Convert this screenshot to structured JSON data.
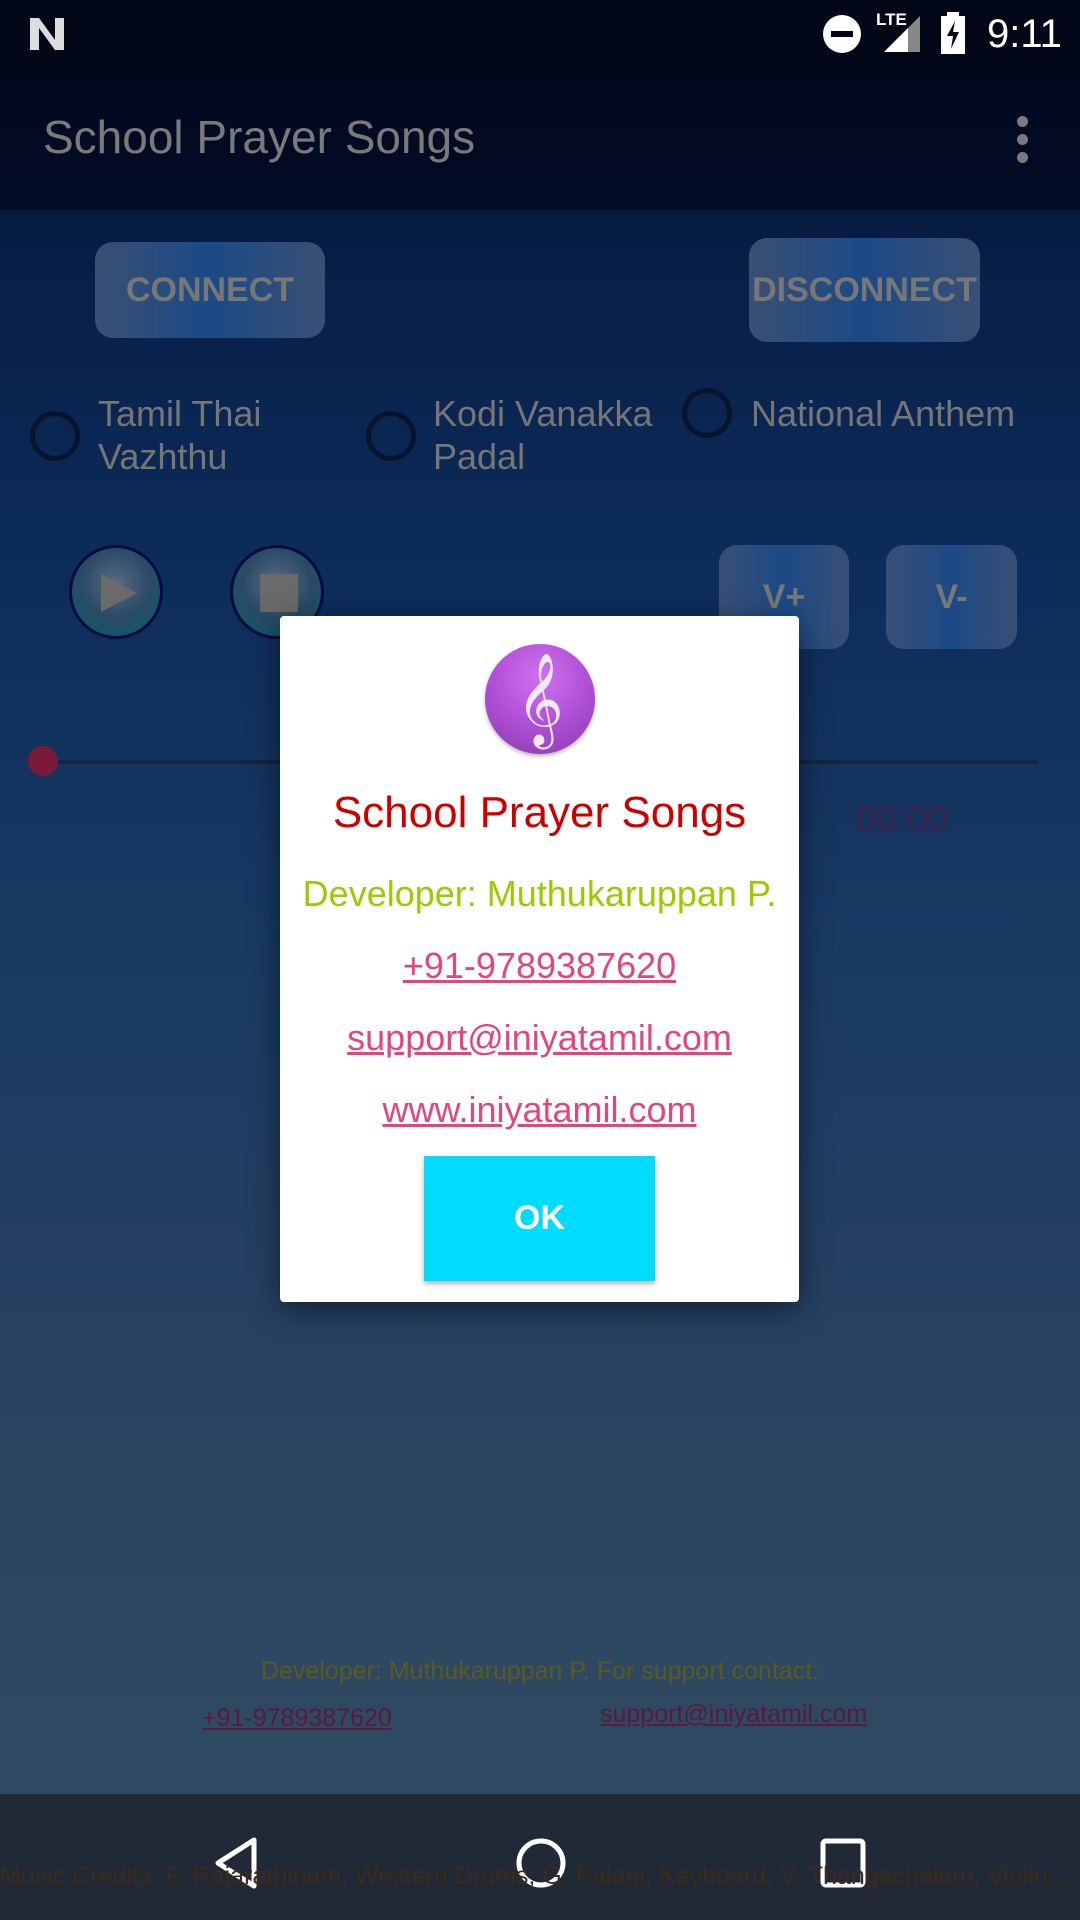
{
  "status_bar": {
    "time": "9:11",
    "network": "LTE",
    "icons": [
      "n-notification-icon",
      "do-not-disturb-icon",
      "signal-icon",
      "battery-charging-icon"
    ]
  },
  "app_bar": {
    "title": "School Prayer Songs",
    "menu_icon": "overflow-menu-icon"
  },
  "controls": {
    "connect": "CONNECT",
    "disconnect": "DISCONNECT",
    "volume_up": "V+",
    "volume_down": "V-",
    "play_icon": "play-icon",
    "stop_icon": "stop-icon"
  },
  "songs": [
    {
      "label_line1": "Tamil Thai",
      "label_line2": "Vazhthu",
      "selected": false
    },
    {
      "label_line1": "Kodi Vanakka",
      "label_line2": "Padal",
      "selected": false
    },
    {
      "label_line1": "National Anthem",
      "label_line2": "",
      "selected": false
    }
  ],
  "player": {
    "progress": 0,
    "time": "00:00"
  },
  "dialog": {
    "icon": "treble-clef-icon",
    "title": "School Prayer Songs",
    "developer": "Developer: Muthukaruppan P.",
    "phone": "+91-9789387620",
    "email": "support@iniyatamil.com",
    "website": "www.iniyatamil.com",
    "ok": "OK",
    "colors": {
      "title": "#cc0000",
      "developer": "#99cc00",
      "link": "#e2457f",
      "ok": "#00dcff"
    }
  },
  "footer": {
    "developer": "Developer: Muthukaruppan P. For support contact:",
    "phone": "+91-9789387620",
    "email": "support@iniyatamil.com",
    "credits": "Music Credits: P. Rajarathinam, Western Drums, G. Palani, Keyboard, V. Thangachalam, Violin..."
  },
  "nav_bar": {
    "back": "back-icon",
    "home": "home-icon",
    "recents": "recents-icon"
  }
}
